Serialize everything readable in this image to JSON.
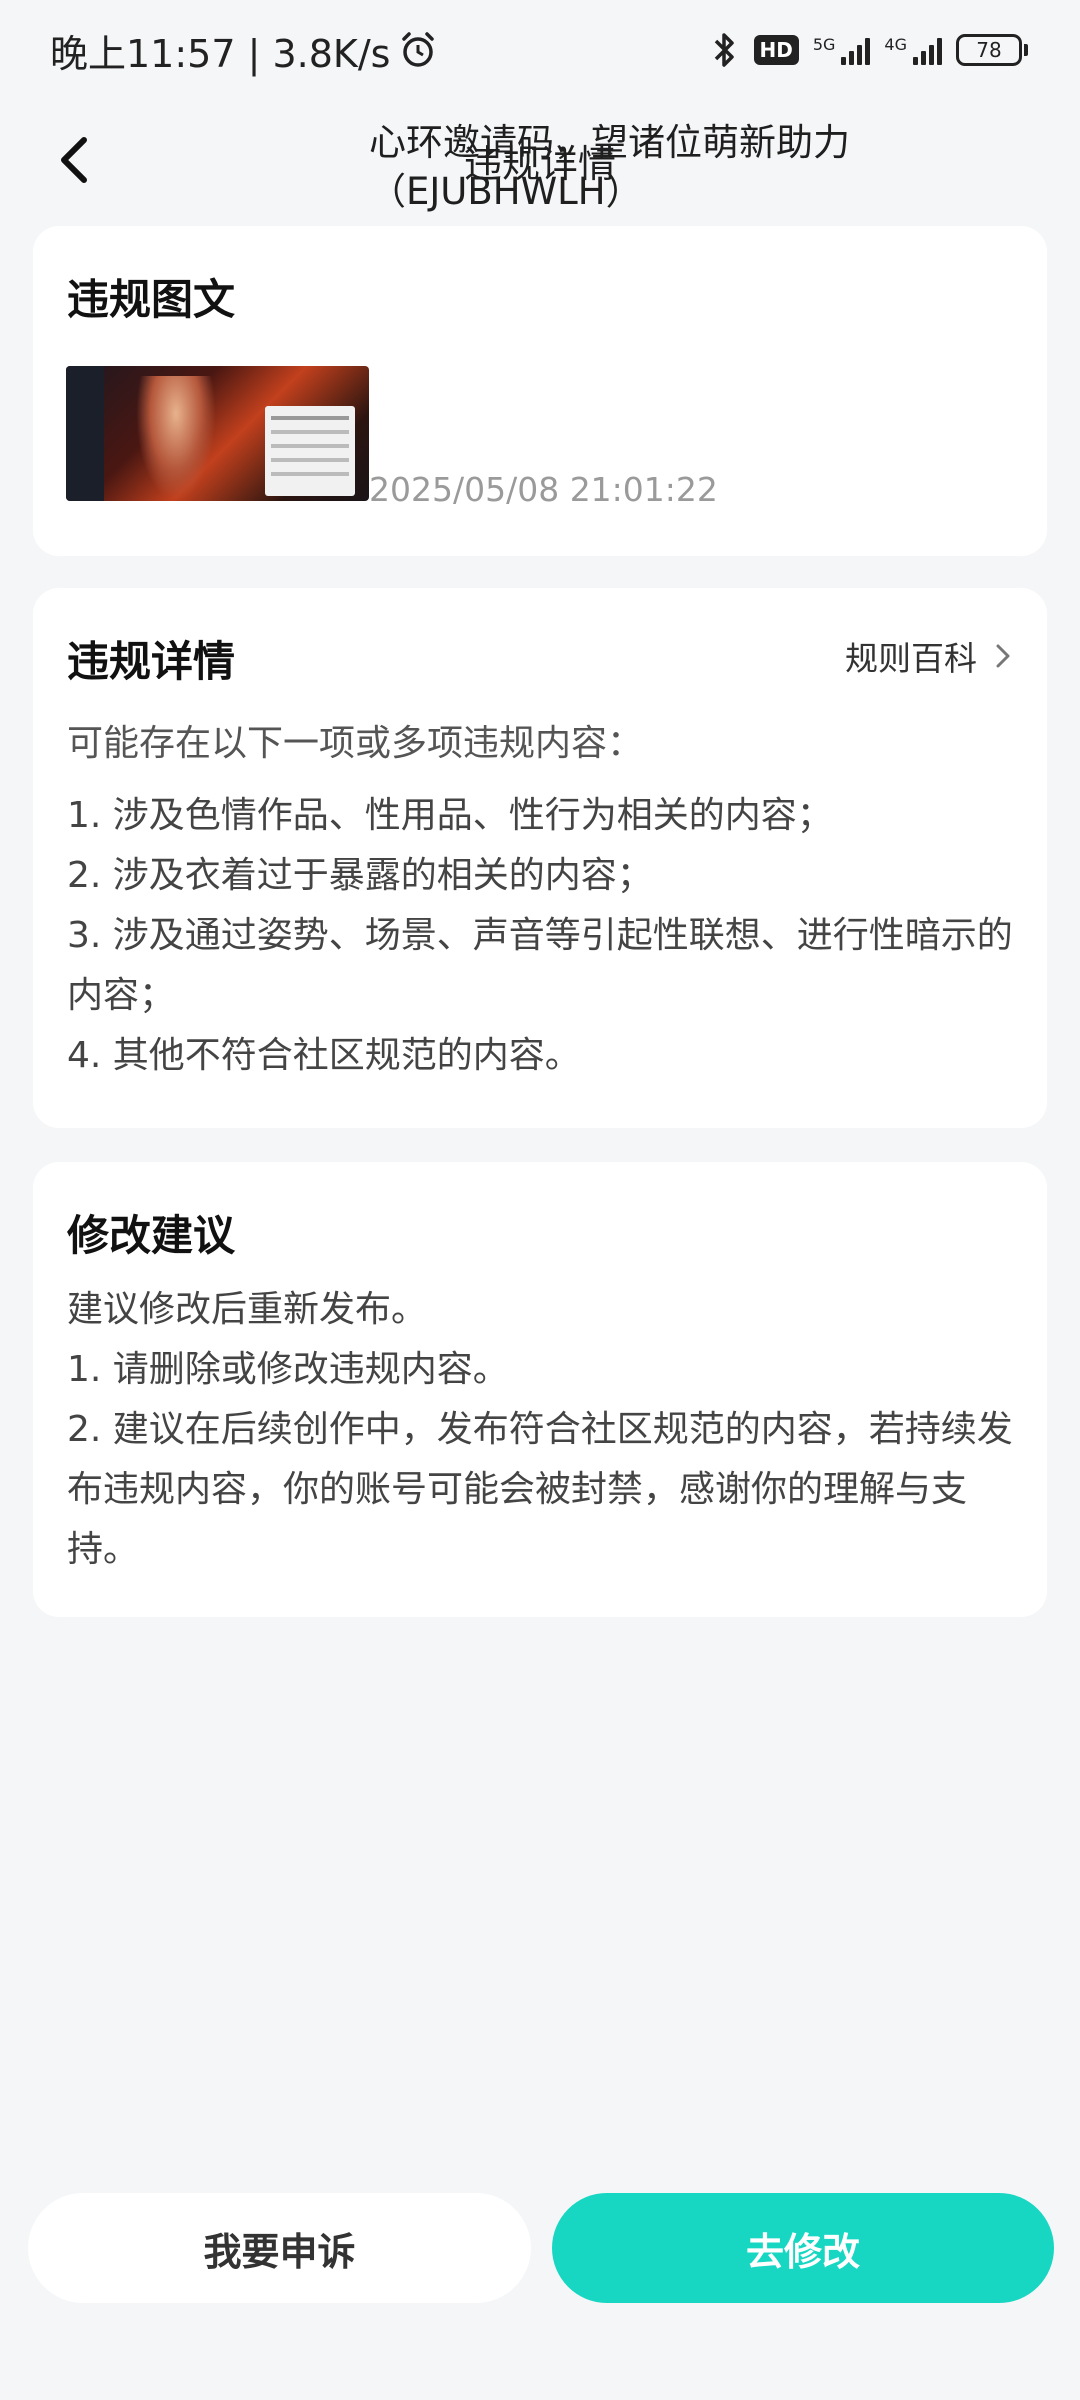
{
  "status_bar": {
    "time_speed": "晚上11:57 | 3.8K/s",
    "hd_label": "HD",
    "net1_label": "5G",
    "net2_label": "4G",
    "battery": "78"
  },
  "header": {
    "title": "违规详情"
  },
  "post_card": {
    "title": "违规图文",
    "post_title": "心环邀请码，望诸位萌新助力（EJUBHWLH）",
    "post_time": "2025/05/08 21:01:22"
  },
  "detail_card": {
    "title": "违规详情",
    "rules_link": "规则百科",
    "intro": "可能存在以下一项或多项违规内容：",
    "items": [
      "1. 涉及色情作品、性用品、性行为相关的内容；",
      "2. 涉及衣着过于暴露的相关的内容；",
      "3. 涉及通过姿势、场景、声音等引起性联想、进行性暗示的内容；",
      "4. 其他不符合社区规范的内容。"
    ]
  },
  "advice_card": {
    "title": "修改建议",
    "lines": [
      "建议修改后重新发布。",
      "1. 请删除或修改违规内容。",
      "2. 建议在后续创作中，发布符合社区规范的内容，若持续发布违规内容，你的账号可能会被封禁，感谢你的理解与支持。"
    ]
  },
  "actions": {
    "appeal": "我要申诉",
    "fix": "去修改"
  },
  "colors": {
    "accent": "#17d7c3",
    "background": "#f5f6f8"
  },
  "icons": [
    "alarm-icon",
    "bluetooth-icon",
    "signal-icon",
    "battery-icon",
    "back-arrow-icon",
    "chevron-right-icon"
  ]
}
